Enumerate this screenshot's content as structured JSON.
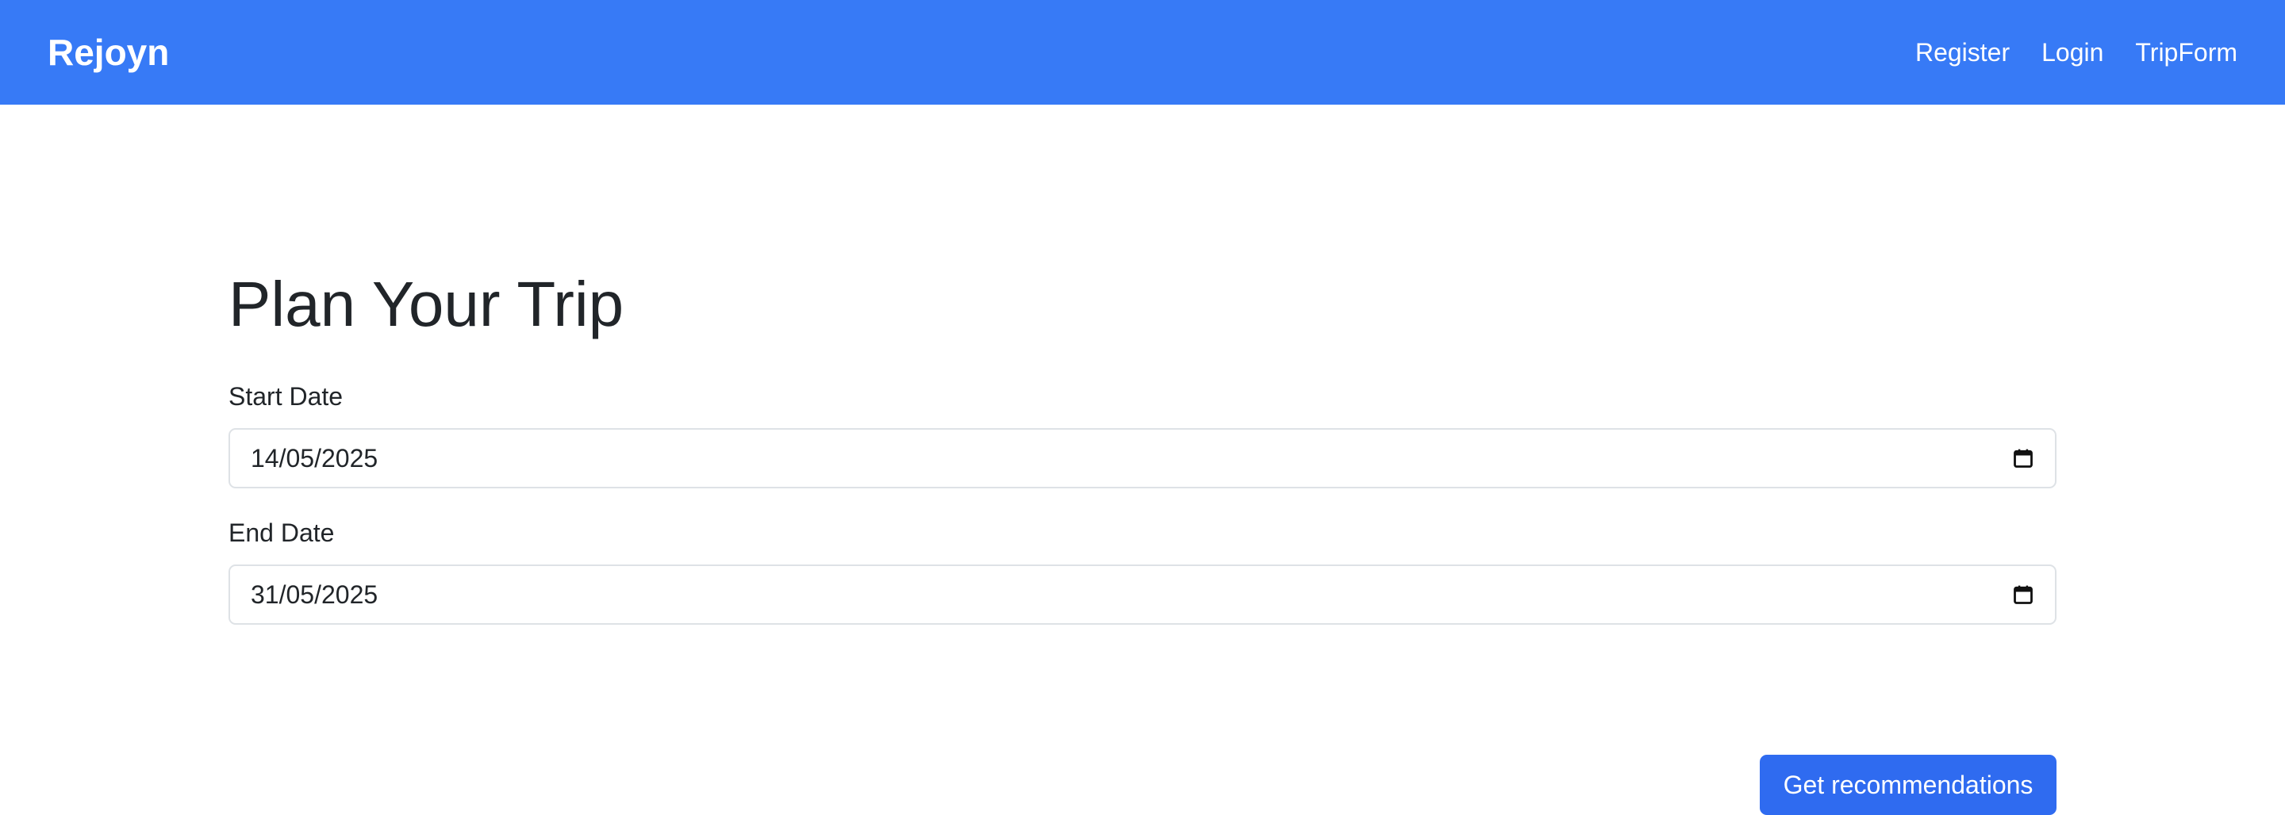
{
  "navbar": {
    "brand": "Rejoyn",
    "links": [
      "Register",
      "Login",
      "TripForm"
    ],
    "background_color": "#377af6"
  },
  "page": {
    "title": "Plan Your Trip"
  },
  "form": {
    "start_date": {
      "label": "Start Date",
      "value": "14/05/2025",
      "icon": "calendar-icon"
    },
    "end_date": {
      "label": "End Date",
      "value": "31/05/2025",
      "icon": "calendar-icon"
    },
    "submit_label": "Get recommendations",
    "button_color": "#2f6bf0"
  }
}
